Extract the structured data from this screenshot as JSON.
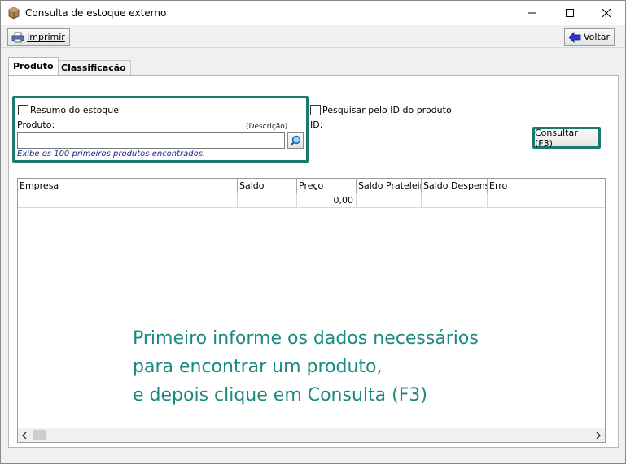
{
  "window": {
    "title": "Consulta de estoque externo",
    "minimize_label": "",
    "maximize_label": "",
    "close_label": ""
  },
  "toolbar": {
    "print_label": "Imprimir",
    "back_label": "Voltar"
  },
  "tabs": [
    {
      "label": "Produto",
      "active": true
    },
    {
      "label": "Classificação",
      "active": false
    }
  ],
  "search": {
    "stock_summary_label": "Resumo do estoque",
    "stock_summary_checked": false,
    "product_label": "Produto:",
    "description_label": "(Descrição)",
    "product_value": "",
    "hint": "Exibe os 100 primeiros produtos encontrados.",
    "search_by_id_label": "Pesquisar pelo ID do produto",
    "search_by_id_checked": false,
    "id_label": "ID:",
    "consult_button": "Consultar (F3)"
  },
  "grid": {
    "columns": [
      "Empresa",
      "Saldo",
      "Preço",
      "Saldo Prateleira",
      "Saldo Despensa",
      "Erro"
    ],
    "rows": [
      [
        "",
        "",
        "0,00",
        "",
        "",
        ""
      ]
    ]
  },
  "message": {
    "line1": "Primeiro informe os dados necessários",
    "line2": "para encontrar um produto,",
    "line3": "e depois clique em Consulta (F3)"
  },
  "colors": {
    "accent": "#1a7a6e",
    "message": "#1a8a7e",
    "hint": "#1a2a8a"
  },
  "icons": [
    "app-box-icon",
    "printer-icon",
    "back-arrow-icon",
    "magnifier-icon",
    "minimize-icon",
    "maximize-icon",
    "close-icon",
    "scroll-left-icon",
    "scroll-right-icon"
  ]
}
